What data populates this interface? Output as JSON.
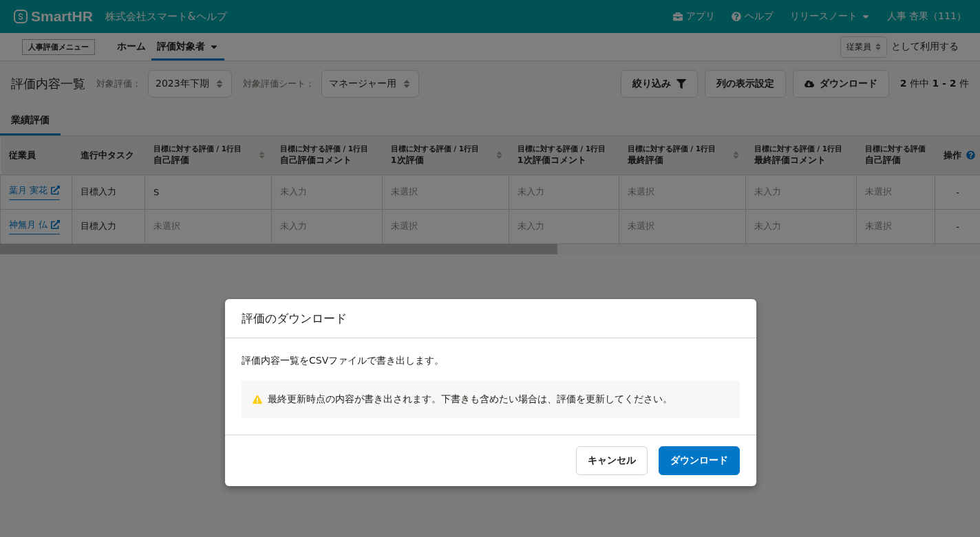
{
  "header": {
    "logo": "SmartHR",
    "company": "株式会社スマート&ヘルプ",
    "links": [
      {
        "kind": "apps",
        "label": "アプリ"
      },
      {
        "kind": "help",
        "label": "ヘルプ"
      },
      {
        "kind": "dropdown",
        "label": "リリースノート"
      },
      {
        "kind": "user",
        "label": "人事 杏果（111）"
      }
    ]
  },
  "subnav": {
    "menu_label": "人事評価メニュー",
    "items": [
      {
        "label": "ホーム",
        "selected": false,
        "dropdown": false
      },
      {
        "label": "評価対象者",
        "selected": true,
        "dropdown": true
      }
    ],
    "role_select": "従業員",
    "role_suffix": "として利用する"
  },
  "toolbar": {
    "title": "評価内容一覧",
    "filters": [
      {
        "label": "対象評価：",
        "value": "2023年下期"
      },
      {
        "label": "対象評価シート：",
        "value": "マネージャー用"
      }
    ],
    "buttons": [
      {
        "kind": "filter",
        "label": "絞り込み"
      },
      {
        "kind": "plain",
        "label": "列の表示設定"
      },
      {
        "kind": "download",
        "label": "ダウンロード"
      }
    ],
    "count": {
      "total": "2",
      "total_unit": "件中",
      "from": "1",
      "sep": "-",
      "to": "2",
      "unit": "件"
    }
  },
  "tabs": [
    {
      "label": "業績評価",
      "selected": true
    }
  ],
  "table": {
    "columns": [
      {
        "main": "従業員",
        "sortable": false,
        "help": false
      },
      {
        "main": "進行中タスク",
        "sortable": false,
        "help": false
      },
      {
        "top": "目標に対する評価 / 1行目",
        "main": "自己評価",
        "sortable": true,
        "help": false
      },
      {
        "top": "目標に対する評価 / 1行目",
        "main": "自己評価コメント",
        "sortable": false,
        "help": false
      },
      {
        "top": "目標に対する評価 / 1行目",
        "main": "1次評価",
        "sortable": true,
        "help": false
      },
      {
        "top": "目標に対する評価 / 1行目",
        "main": "1次評価コメント",
        "sortable": false,
        "help": false
      },
      {
        "top": "目標に対する評価 / 1行目",
        "main": "最終評価",
        "sortable": true,
        "help": false
      },
      {
        "top": "目標に対する評価 / 1行目",
        "main": "最終評価コメント",
        "sortable": false,
        "help": false
      },
      {
        "top": "目標に対する評価",
        "main": "自己評価",
        "sortable": false,
        "help": false
      },
      {
        "main": "操作",
        "sortable": false,
        "help": true
      }
    ],
    "rows": [
      {
        "cells": [
          {
            "kind": "link",
            "text": "葉月 実花"
          },
          {
            "kind": "text",
            "text": "目標入力"
          },
          {
            "kind": "text",
            "text": "S"
          },
          {
            "kind": "empty",
            "text": "未入力"
          },
          {
            "kind": "empty",
            "text": "未選択"
          },
          {
            "kind": "empty",
            "text": "未入力"
          },
          {
            "kind": "empty",
            "text": "未選択"
          },
          {
            "kind": "empty",
            "text": "未入力"
          },
          {
            "kind": "empty",
            "text": "未選択"
          },
          {
            "kind": "center",
            "text": "-"
          }
        ]
      },
      {
        "cells": [
          {
            "kind": "link",
            "text": "神無月 仏"
          },
          {
            "kind": "text",
            "text": "目標入力"
          },
          {
            "kind": "empty",
            "text": "未選択"
          },
          {
            "kind": "empty",
            "text": "未入力"
          },
          {
            "kind": "empty",
            "text": "未選択"
          },
          {
            "kind": "empty",
            "text": "未入力"
          },
          {
            "kind": "empty",
            "text": "未選択"
          },
          {
            "kind": "empty",
            "text": "未入力"
          },
          {
            "kind": "empty",
            "text": "未選択"
          },
          {
            "kind": "center",
            "text": "-"
          }
        ]
      }
    ]
  },
  "dialog": {
    "title": "評価のダウンロード",
    "message": "評価内容一覧をCSVファイルで書き出します。",
    "warning": "最終更新時点の内容が書き出されます。下書きも含めたい場合は、評価を更新してください。",
    "buttons": [
      {
        "kind": "secondary",
        "label": "キャンセル"
      },
      {
        "kind": "primary",
        "label": "ダウンロード"
      }
    ]
  }
}
